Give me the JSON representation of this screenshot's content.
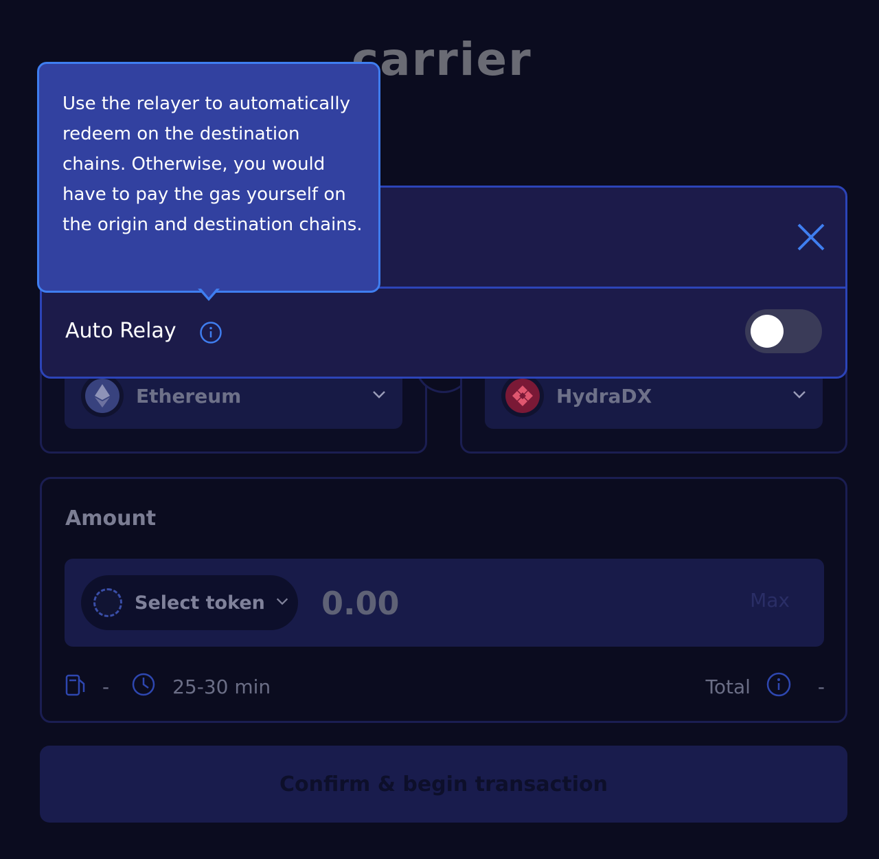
{
  "brand": {
    "logo_text": "carrier"
  },
  "settings_modal": {
    "close_icon": "close-icon",
    "auto_relay": {
      "label": "Auto Relay",
      "info_icon": "info-icon",
      "enabled": false
    }
  },
  "tooltip": {
    "text": "Use the relayer to automatically redeem on the destination chains. Otherwise, you would have to pay the gas yourself on the origin and destination chains."
  },
  "chains": {
    "source": {
      "name": "Ethereum",
      "icon": "ethereum-icon"
    },
    "destination": {
      "name": "HydraDX",
      "icon": "hydradx-icon"
    }
  },
  "amount": {
    "label": "Amount",
    "token_select_label": "Select token",
    "input_placeholder": "0.00",
    "max_label": "Max",
    "gas_value": "-",
    "time_estimate": "25-30 min",
    "total_label": "Total",
    "total_value": "-"
  },
  "confirm_button": {
    "label": "Confirm & begin transaction"
  },
  "colors": {
    "background": "#0b0c1f",
    "modal": "#1c1b4a",
    "tooltip": "#3241a0",
    "accent": "#3f7ef0"
  }
}
